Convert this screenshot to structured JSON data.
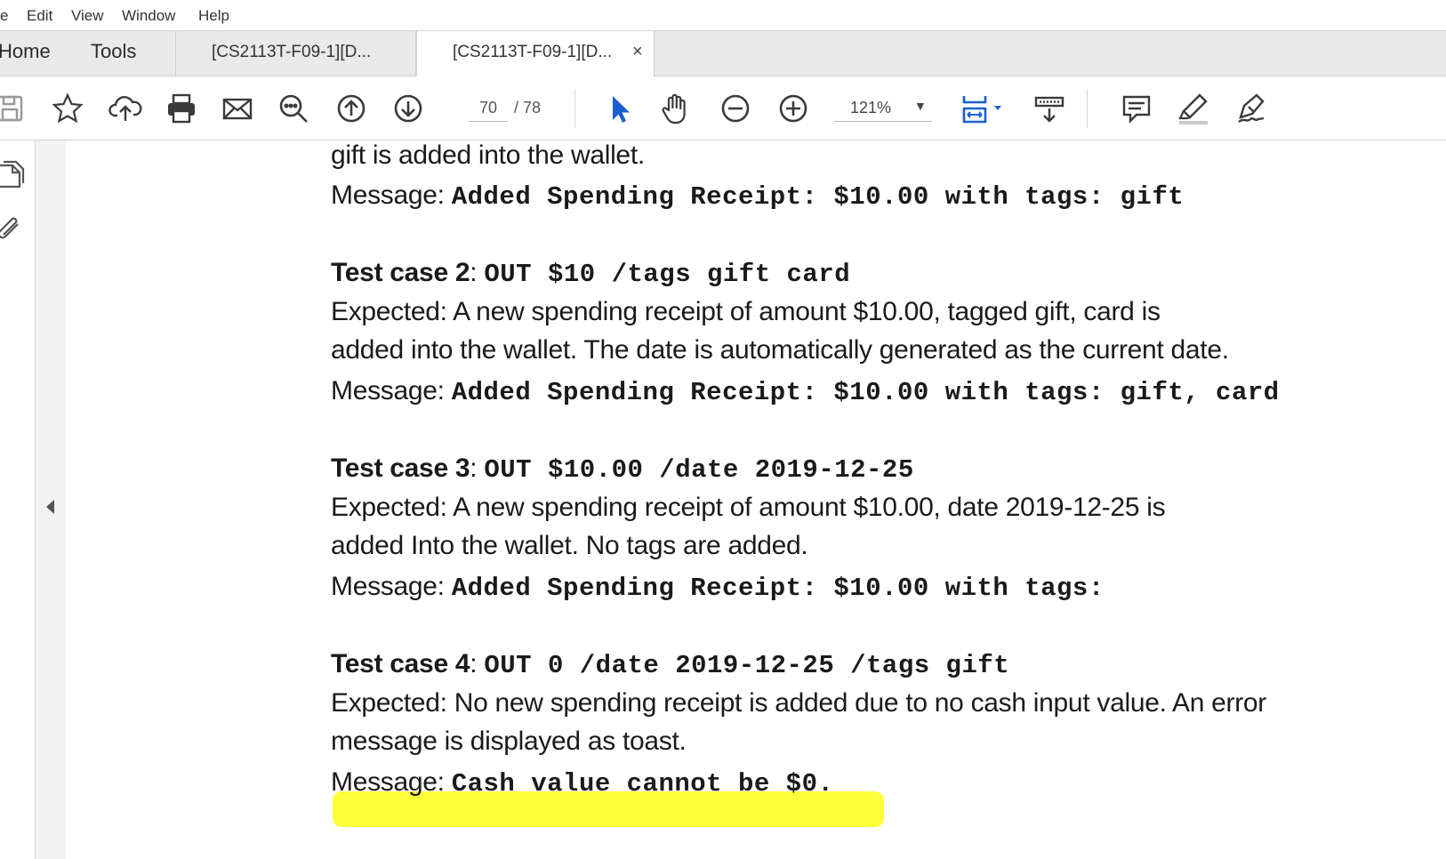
{
  "menubar": {
    "items": [
      "e",
      "Edit",
      "View",
      "Window",
      "Help"
    ]
  },
  "tabs": {
    "home": "Home",
    "tools": "Tools",
    "doc1": "[CS2113T-F09-1][D...",
    "doc2": "[CS2113T-F09-1][D...",
    "close": "×"
  },
  "toolbar": {
    "page_current": "70",
    "page_total": "/ 78",
    "zoom": "121%",
    "icons": [
      "save-icon",
      "star-icon",
      "upload-cloud-icon",
      "print-icon",
      "mail-icon",
      "search-zoom-icon",
      "page-up-icon",
      "page-down-icon",
      "select-cursor-icon",
      "hand-icon",
      "zoom-out-icon",
      "zoom-in-icon",
      "fit-page-icon",
      "scroll-mode-icon",
      "comment-icon",
      "highlight-icon",
      "sign-icon"
    ]
  },
  "document": {
    "line0": "gift is added into the wallet.",
    "case1_message_label": "Message:",
    "case1_message": "Added Spending Receipt: $10.00 with tags: gift",
    "case2_title": "Test case 2",
    "case2_colon": ":",
    "case2_command": "OUT $10 /tags gift card",
    "case2_expected_1": "Expected: A new spending receipt of amount $10.00, tagged gift, card is",
    "case2_expected_2": "added into the wallet. The date is automatically generated as the current date.",
    "case2_message_label": "Message:",
    "case2_message": "Added Spending Receipt: $10.00 with tags: gift, card",
    "case3_title": "Test case 3",
    "case3_colon": ":",
    "case3_command": "OUT $10.00 /date 2019-12-25",
    "case3_expected_1": "Expected: A new spending receipt of amount $10.00, date 2019-12-25 is",
    "case3_expected_2": "added Into the wallet. No tags are added.",
    "case3_message_label": "Message:",
    "case3_message": "Added Spending Receipt: $10.00 with tags:",
    "case4_title": "Test case 4",
    "case4_colon": ":",
    "case4_command": "OUT 0 /date 2019-12-25 /tags gift",
    "case4_expected_1": "Expected: No new spending receipt is added due to no cash input value. An error",
    "case4_expected_2": "message is displayed as toast.",
    "case4_message_label": "Message:",
    "case4_message": "Cash value cannot be $0."
  },
  "colors": {
    "highlight": "#ffff3a",
    "cursor_blue": "#1a5fcf"
  }
}
